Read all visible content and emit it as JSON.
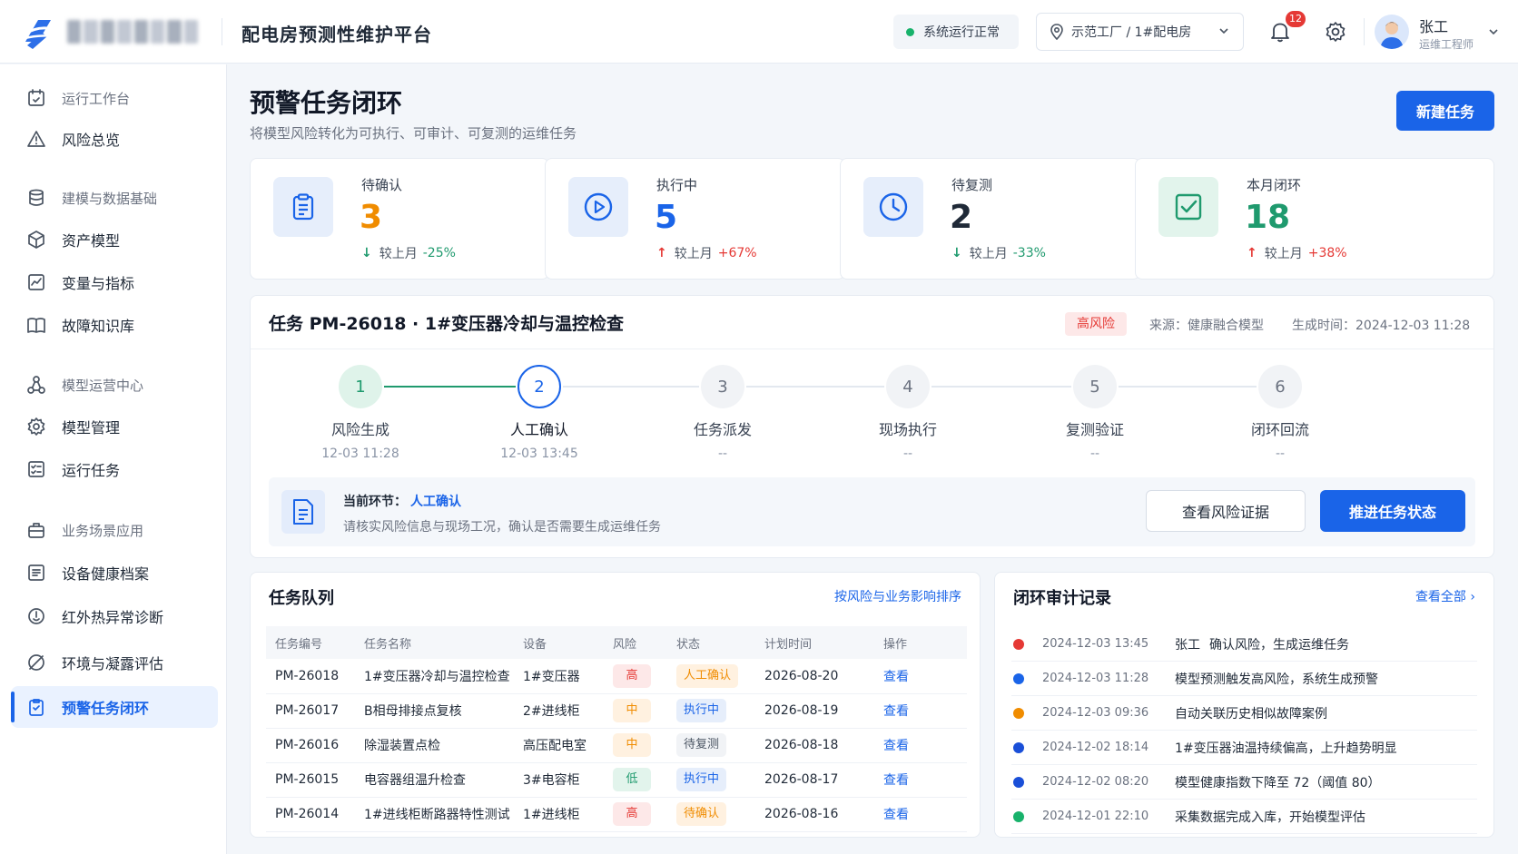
{
  "header": {
    "platform_title": "配电房预测性维护平台",
    "system_status": "系统运行正常",
    "location": "示范工厂 / 1#配电房",
    "notification_count": "12",
    "user_name": "张工",
    "user_role": "运维工程师"
  },
  "sidebar": {
    "items": [
      {
        "label": "运行工作台",
        "icon": "workbench-icon",
        "type": "group"
      },
      {
        "label": "风险总览",
        "icon": "warning-triangle-icon",
        "type": "item"
      },
      {
        "label": "建模与数据基础",
        "icon": "database-icon",
        "type": "group"
      },
      {
        "label": "资产模型",
        "icon": "cube-icon",
        "type": "item"
      },
      {
        "label": "变量与指标",
        "icon": "chart-box-icon",
        "type": "item"
      },
      {
        "label": "故障知识库",
        "icon": "book-icon",
        "type": "item"
      },
      {
        "label": "模型运营中心",
        "icon": "network-icon",
        "type": "group"
      },
      {
        "label": "模型管理",
        "icon": "gear-icon",
        "type": "item"
      },
      {
        "label": "运行任务",
        "icon": "task-list-icon",
        "type": "item"
      },
      {
        "label": "业务场景应用",
        "icon": "briefcase-icon",
        "type": "group"
      },
      {
        "label": "设备健康档案",
        "icon": "file-list-icon",
        "type": "item"
      },
      {
        "label": "红外热异常诊断",
        "icon": "thermal-icon",
        "type": "item"
      },
      {
        "label": "环境与凝露评估",
        "icon": "leaf-icon",
        "type": "item"
      },
      {
        "label": "预警任务闭环",
        "icon": "clipboard-check-icon",
        "type": "active"
      }
    ]
  },
  "page": {
    "title": "预警任务闭环",
    "subtitle": "将模型风险转化为可执行、可审计、可复测的运维任务",
    "new_task_label": "新建任务"
  },
  "stats": [
    {
      "label": "待确认",
      "value": "3",
      "trend_label": "较上月",
      "trend": "-25%",
      "direction": "down",
      "value_color": "#f08c00",
      "icon": "clipboard-icon",
      "icon_bg": "#e6eefb",
      "icon_color": "#1a64e8"
    },
    {
      "label": "执行中",
      "value": "5",
      "trend_label": "较上月",
      "trend": "+67%",
      "direction": "up",
      "value_color": "#1a64e8",
      "icon": "play-circle-icon",
      "icon_bg": "#e6eefb",
      "icon_color": "#1a64e8"
    },
    {
      "label": "待复测",
      "value": "2",
      "trend_label": "较上月",
      "trend": "-33%",
      "direction": "down",
      "value_color": "#1f2937",
      "icon": "clock-icon",
      "icon_bg": "#e6eefb",
      "icon_color": "#1a64e8"
    },
    {
      "label": "本月闭环",
      "value": "18",
      "trend_label": "较上月",
      "trend": "+38%",
      "direction": "up",
      "value_color": "#1f9a6e",
      "icon": "checkbox-icon",
      "icon_bg": "#e2f4ec",
      "icon_color": "#1f9a6e"
    }
  ],
  "task": {
    "title": "任务 PM-26018 · 1#变压器冷却与温控检查",
    "risk": "高风险",
    "source": "来源：健康融合模型",
    "generated": "生成时间：2024-12-03 11:28",
    "steps": [
      {
        "num": "1",
        "name": "风险生成",
        "time": "12-03 11:28",
        "state": "done"
      },
      {
        "num": "2",
        "name": "人工确认",
        "time": "12-03 13:45",
        "state": "current"
      },
      {
        "num": "3",
        "name": "任务派发",
        "time": "--",
        "state": "pending"
      },
      {
        "num": "4",
        "name": "现场执行",
        "time": "--",
        "state": "pending"
      },
      {
        "num": "5",
        "name": "复测验证",
        "time": "--",
        "state": "pending"
      },
      {
        "num": "6",
        "name": "闭环回流",
        "time": "--",
        "state": "pending"
      }
    ],
    "current_label": "当前环节：",
    "current_step": "人工确认",
    "current_desc": "请核实风险信息与现场工况，确认是否需要生成运维任务",
    "btn_evidence": "查看风险证据",
    "btn_advance": "推进任务状态"
  },
  "queue": {
    "title": "任务队列",
    "sort_label": "按风险与业务影响排序",
    "columns": [
      "任务编号",
      "任务名称",
      "设备",
      "风险",
      "状态",
      "计划时间",
      "操作"
    ],
    "rows": [
      {
        "id": "PM-26018",
        "name": "1#变压器冷却与温控检查",
        "device": "1#变压器",
        "risk": "高",
        "risk_level": "high",
        "status": "人工确认",
        "status_type": "confirm",
        "date": "2026-08-20",
        "action": "查看"
      },
      {
        "id": "PM-26017",
        "name": "B相母排接点复核",
        "device": "2#进线柜",
        "risk": "中",
        "risk_level": "mid",
        "status": "执行中",
        "status_type": "running",
        "date": "2026-08-19",
        "action": "查看"
      },
      {
        "id": "PM-26016",
        "name": "除湿装置点检",
        "device": "高压配电室",
        "risk": "中",
        "risk_level": "mid",
        "status": "待复测",
        "status_type": "retest",
        "date": "2026-08-18",
        "action": "查看"
      },
      {
        "id": "PM-26015",
        "name": "电容器组温升检查",
        "device": "3#电容柜",
        "risk": "低",
        "risk_level": "low",
        "status": "执行中",
        "status_type": "running",
        "date": "2026-08-17",
        "action": "查看"
      },
      {
        "id": "PM-26014",
        "name": "1#进线柜断路器特性测试",
        "device": "1#进线柜",
        "risk": "高",
        "risk_level": "high",
        "status": "待确认",
        "status_type": "pending",
        "date": "2026-08-16",
        "action": "查看"
      }
    ]
  },
  "audit": {
    "title": "闭环审计记录",
    "view_all": "查看全部 ›",
    "records": [
      {
        "time": "2024-12-03 13:45",
        "user": "张工",
        "text": "确认风险，生成运维任务",
        "color": "#e53935"
      },
      {
        "time": "2024-12-03 11:28",
        "user": "",
        "text": "模型预测触发高风险，系统生成预警",
        "color": "#1a64e8"
      },
      {
        "time": "2024-12-03 09:36",
        "user": "",
        "text": "自动关联历史相似故障案例",
        "color": "#f08c00"
      },
      {
        "time": "2024-12-02 18:14",
        "user": "",
        "text": "1#变压器油温持续偏高，上升趋势明显",
        "color": "#1a4fd8"
      },
      {
        "time": "2024-12-02 08:20",
        "user": "",
        "text": "模型健康指数下降至 72（阈值 80）",
        "color": "#1a4fd8"
      },
      {
        "time": "2024-12-01 22:10",
        "user": "",
        "text": "采集数据完成入库，开始模型评估",
        "color": "#18b26b"
      }
    ]
  }
}
